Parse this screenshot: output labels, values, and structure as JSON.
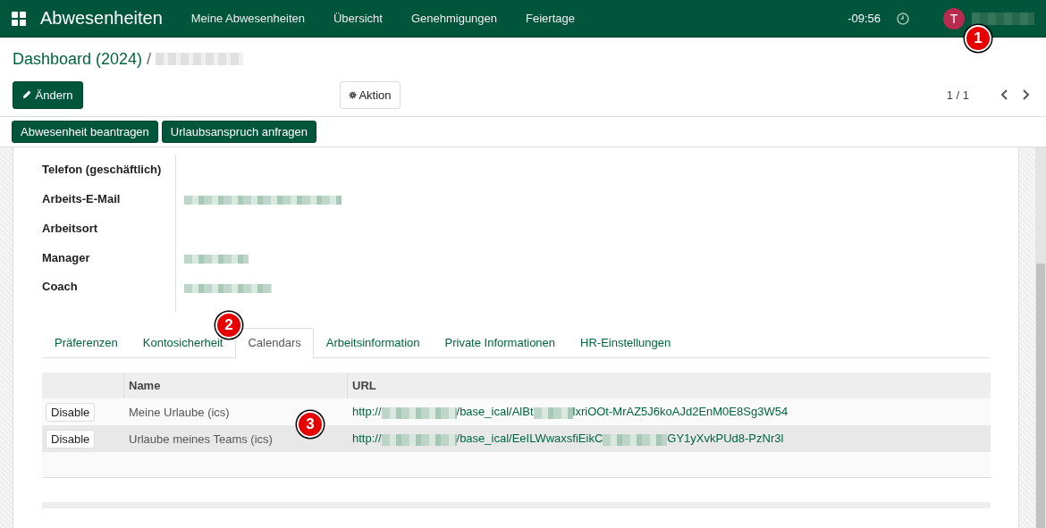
{
  "navbar": {
    "app_title": "Abwesenheiten",
    "menu": [
      "Meine Abwesenheiten",
      "Übersicht",
      "Genehmigungen",
      "Feiertage"
    ],
    "timer": "-09:56",
    "avatar_letter": "T"
  },
  "breadcrumb": {
    "parent": "Dashboard (2024)",
    "separator": "/"
  },
  "toolbar": {
    "edit_button": "Ändern",
    "action_button": "Aktion",
    "pager": "1 / 1"
  },
  "header_buttons": [
    "Abwesenheit beantragen",
    "Urlaubsanspruch anfragen"
  ],
  "fields": [
    {
      "label": "Telefon (geschäftlich)",
      "redacted": false
    },
    {
      "label": "Arbeits-E-Mail",
      "redacted": true
    },
    {
      "label": "Arbeitsort",
      "redacted": false
    },
    {
      "label": "Manager",
      "redacted": true
    },
    {
      "label": "Coach",
      "redacted": true
    }
  ],
  "tabs": [
    {
      "label": "Präferenzen",
      "selected": false
    },
    {
      "label": "Kontosicherheit",
      "selected": false
    },
    {
      "label": "Calendars",
      "selected": true
    },
    {
      "label": "Arbeitsinformation",
      "selected": false
    },
    {
      "label": "Private Informationen",
      "selected": false
    },
    {
      "label": "HR-Einstellungen",
      "selected": false
    }
  ],
  "table": {
    "columns": [
      "Name",
      "URL"
    ],
    "rows": [
      {
        "button": "Disable",
        "name": "Meine Urlaube (ics)",
        "url_parts": [
          "http://",
          "/base_ical/AlBt",
          "lxriOOt-MrAZ5J6koAJd2EnM0E8Sg3W54"
        ]
      },
      {
        "button": "Disable",
        "name": "Urlaube meines Teams (ics)",
        "url_parts": [
          "http://",
          "/base_ical/EeILWwaxsfiEikC",
          "GY1yXvkPUd8-PzNr3l"
        ]
      }
    ]
  },
  "callouts": [
    "1",
    "2",
    "3"
  ]
}
